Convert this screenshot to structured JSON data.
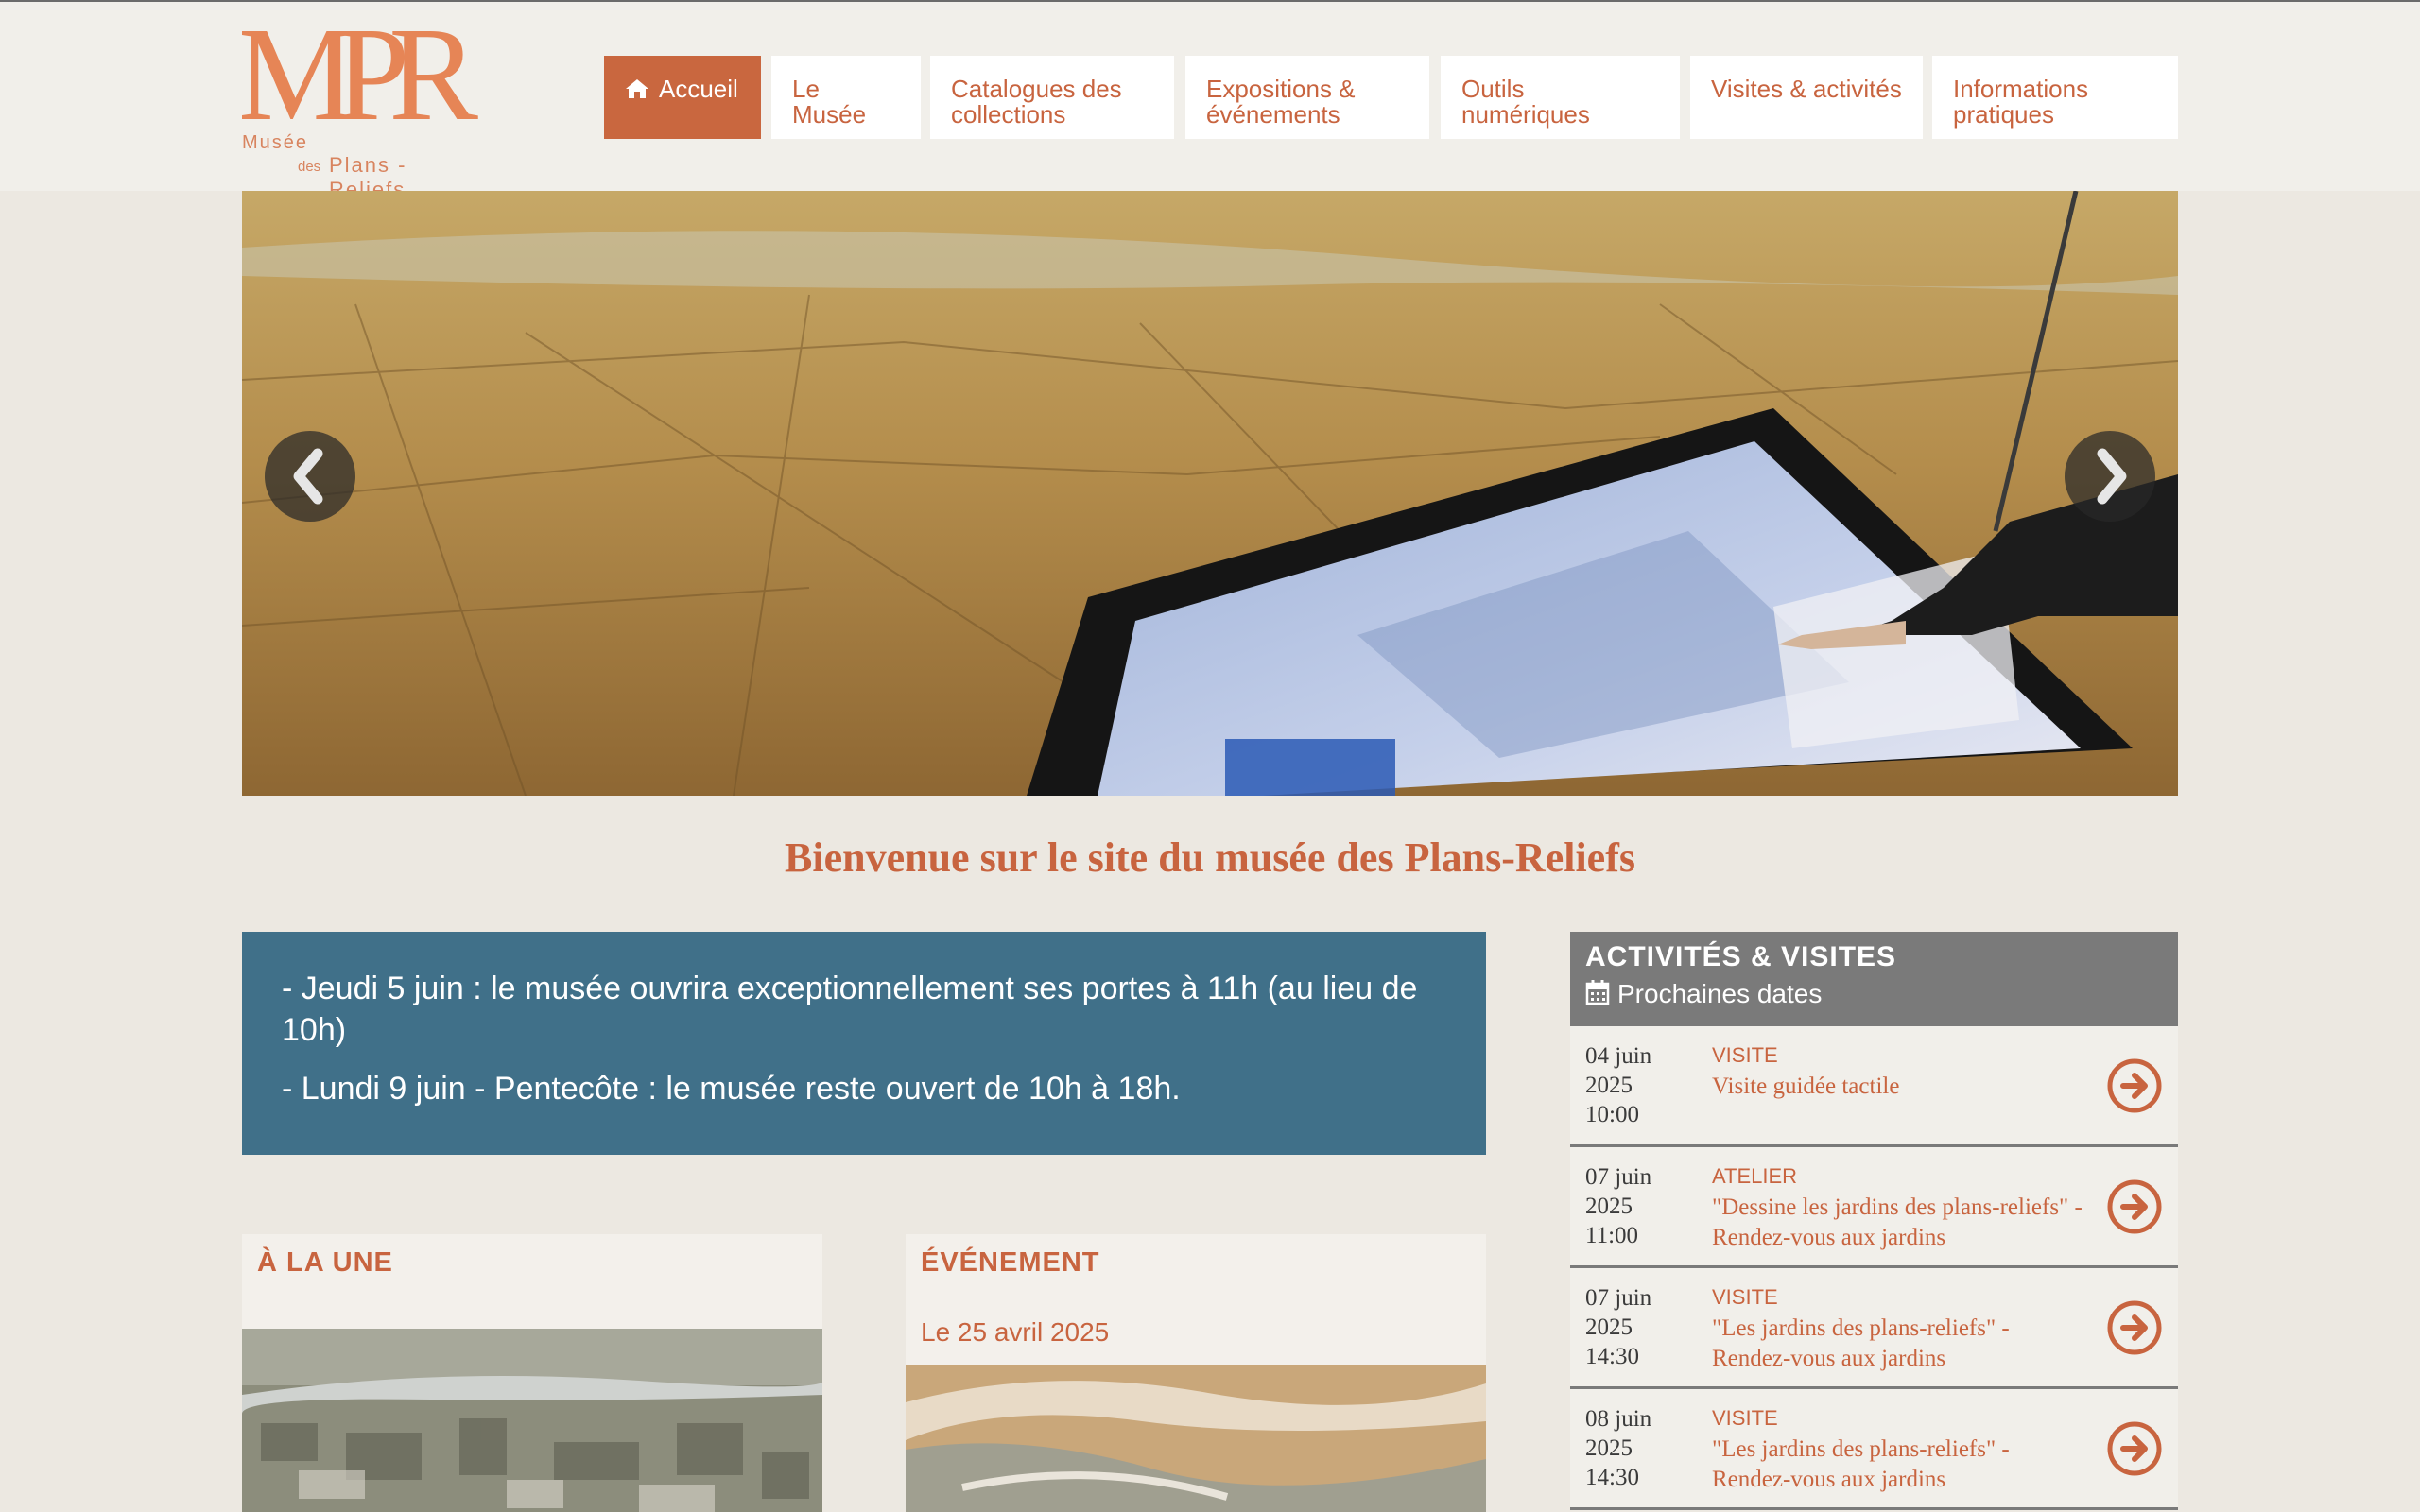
{
  "logo": {
    "letters": "MPR",
    "line1": "Musée",
    "line2": "des",
    "line3": "Plans - Reliefs"
  },
  "nav": {
    "items": [
      {
        "label": "Accueil",
        "active": true
      },
      {
        "label": "Le Musée"
      },
      {
        "label": "Catalogues des collections"
      },
      {
        "label": "Expositions & événements"
      },
      {
        "label": "Outils numériques"
      },
      {
        "label": "Visites & activités"
      },
      {
        "label": "Informations pratiques"
      }
    ]
  },
  "carousel": {
    "prev_icon": "chevron-left-icon",
    "next_icon": "chevron-right-icon"
  },
  "welcome": "Bienvenue sur le site du musée des Plans-Reliefs",
  "notice": {
    "line1": "- Jeudi 5 juin : le musée ouvrira exceptionnellement ses portes à 11h (au lieu de 10h)",
    "line2": "- Lundi 9 juin - Pentecôte : le musée reste ouvert de 10h à 18h."
  },
  "cards": {
    "une": {
      "title": "À LA UNE"
    },
    "evenement": {
      "title": "ÉVÉNEMENT",
      "date": "Le 25 avril 2025"
    }
  },
  "sidebar": {
    "title": "ACTIVITÉS & VISITES",
    "subtitle": "Prochaines dates",
    "events": [
      {
        "day": "04 juin",
        "year": "2025",
        "time": "10:00",
        "type": "VISITE",
        "title": "Visite guidée tactile"
      },
      {
        "day": "07 juin",
        "year": "2025",
        "time": "11:00",
        "type": "ATELIER",
        "title": "\"Dessine les jardins des plans-reliefs\" - Rendez-vous aux jardins"
      },
      {
        "day": "07 juin",
        "year": "2025",
        "time": "14:30",
        "type": "VISITE",
        "title": "\"Les jardins des plans-reliefs\" - Rendez-vous aux jardins"
      },
      {
        "day": "08 juin",
        "year": "2025",
        "time": "14:30",
        "type": "VISITE",
        "title": "\"Les jardins des plans-reliefs\" - Rendez-vous aux jardins"
      }
    ]
  },
  "colors": {
    "accent": "#c8643f",
    "notice_bg": "#407089",
    "sidebar_head": "#7a7a7a",
    "page_bg": "#ece8e1"
  }
}
